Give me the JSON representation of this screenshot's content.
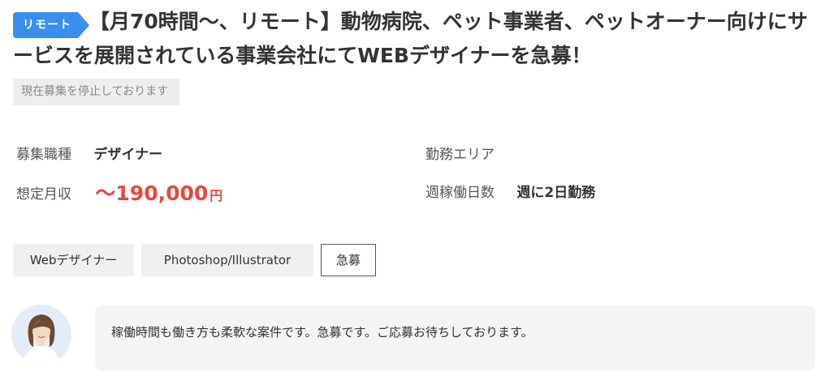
{
  "job": {
    "badge": "リモート",
    "title": "【月70時間〜、リモート】動物病院、ペット事業者、ペットオーナー向けにサービスを展開されている事業会社にてWEBデザイナーを急募！",
    "status": "現在募集を停止しております"
  },
  "info": {
    "category_label": "募集職種",
    "category_value": "デザイナー",
    "area_label": "勤務エリア",
    "area_value": "",
    "salary_label": "想定月収",
    "salary_value": "〜190,000",
    "salary_unit": "円",
    "days_label": "週稼働日数",
    "days_value": "週に2日勤務"
  },
  "tags": [
    "Webデザイナー",
    "Photoshop/Illustrator",
    "急募"
  ],
  "comment": {
    "text": "稼働時間も働き方も柔軟な案件です。急募です。ご応募お待ちしております。"
  },
  "colors": {
    "badge": "#3b8def",
    "salary": "#e8473f",
    "status_bg": "#eeeeee",
    "tag_bg": "#f0f0f0",
    "bubble_bg": "#f4f4f4"
  }
}
